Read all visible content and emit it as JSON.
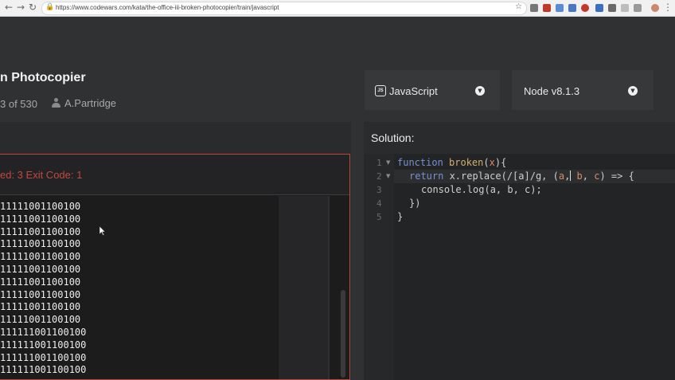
{
  "browser": {
    "url": "https://www.codewars.com/kata/the-office-iii-broken-photocopier/train/javascript",
    "icons": [
      "back-icon",
      "forward-icon",
      "reload-icon",
      "lock-icon",
      "star-icon"
    ]
  },
  "kata": {
    "title": "n Photocopier",
    "rank_prefix": "3",
    "rank_suffix": " of 530",
    "author": "A.Partridge"
  },
  "toolbar": {
    "language": "JavaScript",
    "version": "Node v8.1.3"
  },
  "output": {
    "status": "ed: 3   Exit Code: 1",
    "lines": [
      "11111001100100",
      "11111001100100",
      "11111001100100",
      "11111001100100",
      "11111001100100",
      "11111001100100",
      "11111001100100",
      "11111001100100",
      "11111001100100",
      "11111001100100",
      "111111001100100",
      "111111001100100",
      "111111001100100",
      "111111001100100"
    ]
  },
  "solution": {
    "label": "Solution:",
    "line_numbers": [
      "1",
      "2",
      "3",
      "4",
      "5"
    ],
    "code": {
      "l1_kw": "function",
      "l1_fn": "broken",
      "l1_open": "(",
      "l1_p": "x",
      "l1_close": "){",
      "l2_kw": "return",
      "l2_a": " x.replace(/[a]/g, (",
      "l2_p1": "a",
      "l2_b": ",",
      "l2_p2": " b",
      "l2_c": ", ",
      "l2_p3": "c",
      "l2_d": ") => {",
      "l3": "console.log(a, b, c);",
      "l4": "})",
      "l5": "}"
    }
  },
  "colors": {
    "error_red": "#c1493d",
    "background": "#303133"
  }
}
